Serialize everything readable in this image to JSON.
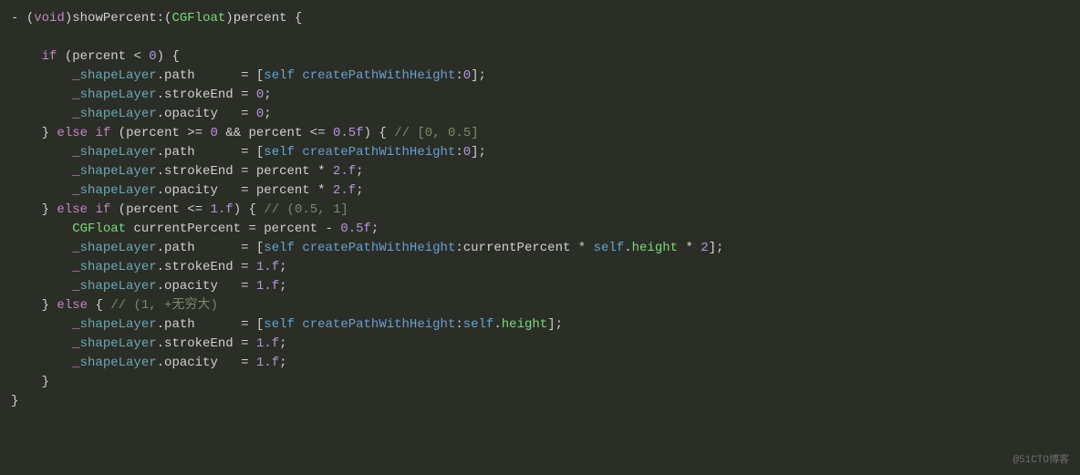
{
  "code": {
    "t_dash": "-",
    "t_void": "void",
    "t_showPercent": "showPercent",
    "t_cgfloat": "CGFloat",
    "t_percent": "percent",
    "t_if": "if",
    "t_else": "else",
    "t_lt": "<",
    "t_gte": ">=",
    "t_lte": "<=",
    "t_and": "&&",
    "t_zero": "0",
    "t_halfF": "0.5f",
    "t_oneF": "1.f",
    "t_shapeLayer": "shapeLayer",
    "t_path": "path",
    "t_strokeEnd": "strokeEnd",
    "t_opacity": "opacity",
    "t_self": "self",
    "t_createPath": "createPathWithHeight",
    "t_height": "height",
    "t_currentPercent": "currentPercent",
    "t_minus": "-",
    "t_mul": "*",
    "t_eq": "=",
    "t_twoF": "2.f",
    "t_two": "2",
    "t_cmt1": "// [0, 0.5]",
    "t_cmt2": "// (0.5, 1]",
    "t_cmt3": "// (1, +无穷大)",
    "t_under": "_"
  },
  "watermark": "@51CTO博客"
}
